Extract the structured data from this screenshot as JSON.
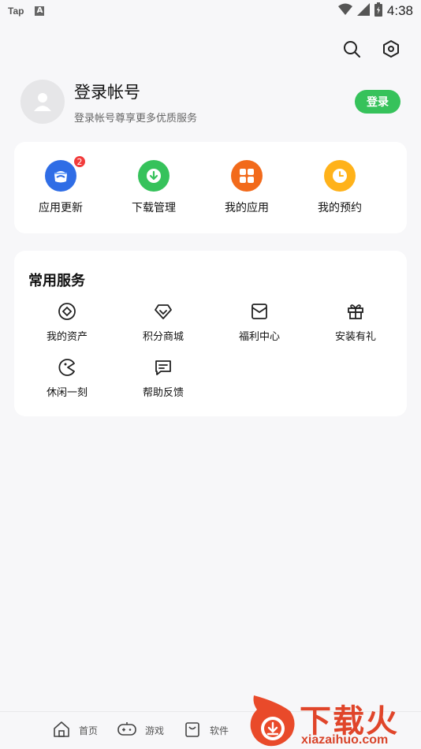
{
  "status_bar": {
    "left_icons": [
      "Tap",
      "A"
    ],
    "time": "4:38"
  },
  "top_actions": {
    "search_icon": "search-icon",
    "settings_icon": "settings-icon"
  },
  "profile": {
    "title": "登录帐号",
    "subtitle": "登录帐号尊享更多优质服务",
    "login_label": "登录"
  },
  "quick_actions": [
    {
      "label": "应用更新",
      "color": "#2f6de6",
      "badge": "2",
      "icon": "update-icon"
    },
    {
      "label": "下载管理",
      "color": "#36c25b",
      "icon": "download-icon"
    },
    {
      "label": "我的应用",
      "color": "#f26a1b",
      "icon": "apps-grid-icon"
    },
    {
      "label": "我的预约",
      "color": "#ffb21a",
      "icon": "clock-icon"
    }
  ],
  "services": {
    "title": "常用服务",
    "items": [
      {
        "label": "我的资产",
        "icon": "asset-icon"
      },
      {
        "label": "积分商城",
        "icon": "diamond-icon"
      },
      {
        "label": "福利中心",
        "icon": "envelope-icon"
      },
      {
        "label": "安装有礼",
        "icon": "gift-icon"
      },
      {
        "label": "休闲一刻",
        "icon": "pacman-icon"
      },
      {
        "label": "帮助反馈",
        "icon": "feedback-icon"
      }
    ]
  },
  "bottom_nav": [
    {
      "label": "首页",
      "icon": "home-icon"
    },
    {
      "label": "游戏",
      "icon": "gamepad-icon"
    },
    {
      "label": "软件",
      "icon": "bag-icon"
    }
  ],
  "watermark": {
    "text": "下载火",
    "domain": "xiazaihuo.com"
  }
}
